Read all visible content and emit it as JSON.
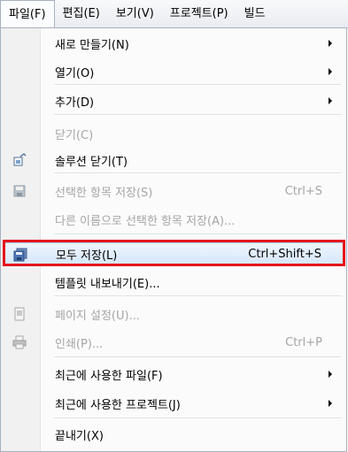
{
  "menubar": {
    "items": [
      "파일(F)",
      "편집(E)",
      "보기(V)",
      "프로젝트(P)",
      "빌드"
    ]
  },
  "menu": {
    "new": "새로 만들기(N)",
    "open": "열기(O)",
    "add": "추가(D)",
    "close": "닫기(C)",
    "close_solution": "솔루션 닫기(T)",
    "save_selected": "선택한 항목 저장(S)",
    "save_selected_shortcut": "Ctrl+S",
    "save_selected_as": "다른 이름으로 선택한 항목 저장(A)...",
    "save_all": "모두 저장(L)",
    "save_all_shortcut": "Ctrl+Shift+S",
    "export_template": "템플릿 내보내기(E)...",
    "page_setup": "페이지 설정(U)...",
    "print": "인쇄(P)...",
    "print_shortcut": "Ctrl+P",
    "recent_files": "최근에 사용한 파일(F)",
    "recent_projects": "최근에 사용한 프로젝트(J)",
    "exit": "끝내기(X)"
  },
  "colors": {
    "highlight_border": "#a8cbee",
    "annotation_red": "#e4151b",
    "disabled_text": "#a5a5a5"
  }
}
